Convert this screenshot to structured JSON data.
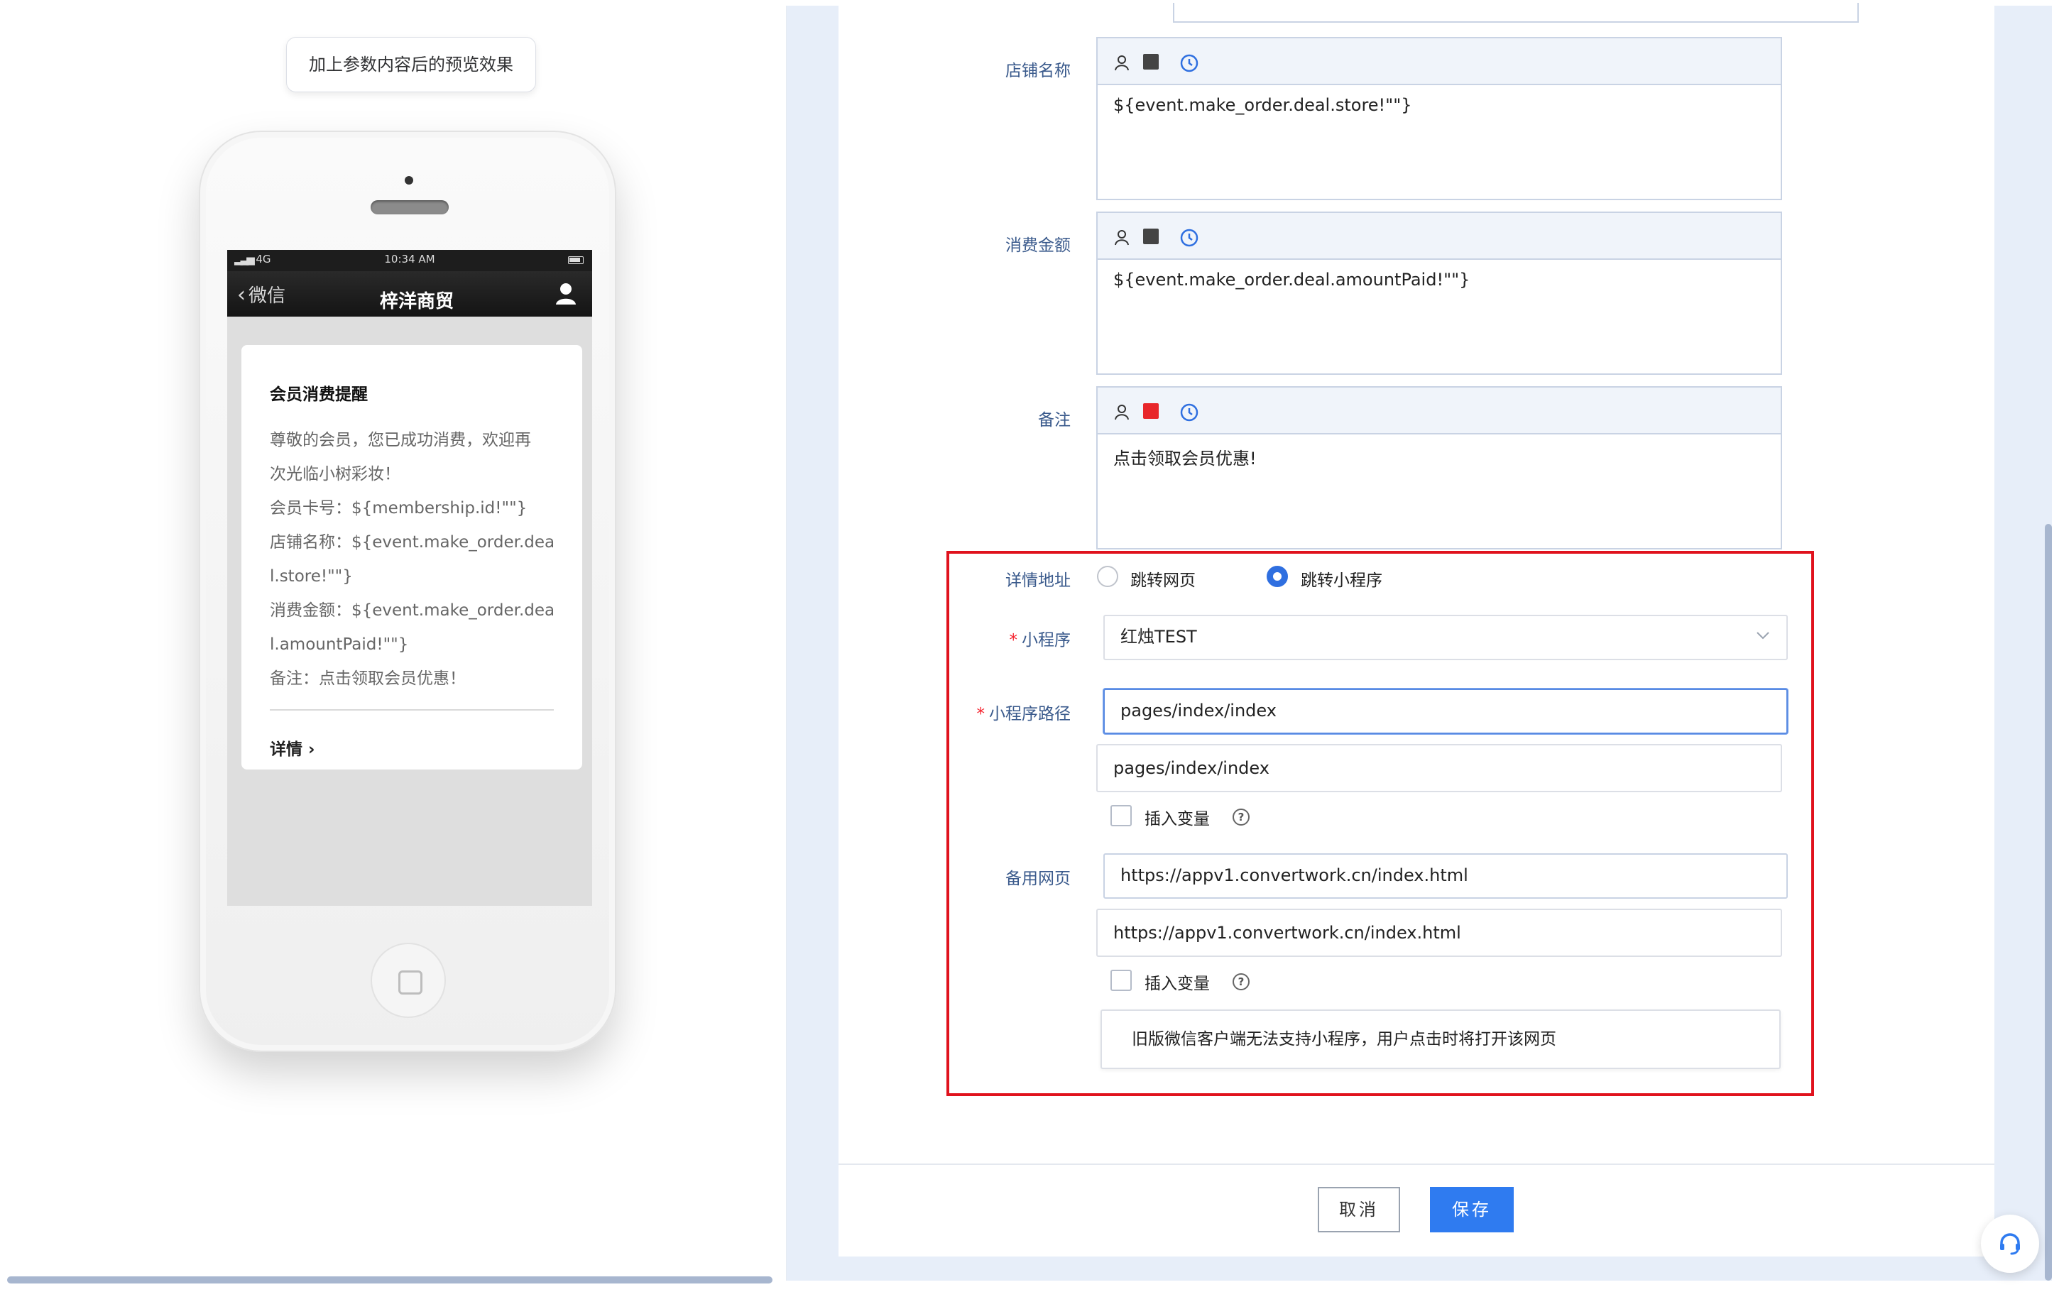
{
  "preview": {
    "caption": "加上参数内容后的预览效果",
    "status_bar": {
      "signal": "4G",
      "time": "10:34 AM"
    },
    "nav": {
      "back_label": "微信",
      "title": "梓洋商贸"
    },
    "card": {
      "title": "会员消费提醒",
      "lines": [
        "尊敬的会员，您已成功消费，欢迎再",
        "次光临小树彩妆！",
        "会员卡号：${membership.id!\"\"}",
        "店铺名称：${event.make_order.dea",
        "l.store!\"\"}",
        "消费金额：${event.make_order.dea",
        "l.amountPaid!\"\"}",
        "备注：点击领取会员优惠！"
      ],
      "detail_link": "详情"
    }
  },
  "form": {
    "fields": [
      {
        "label": "店铺名称",
        "value": "${event.make_order.deal.store!\"\"}",
        "color": "#444444"
      },
      {
        "label": "消费金额",
        "value": "${event.make_order.deal.amountPaid!\"\"}",
        "color": "#444444"
      },
      {
        "label": "备注",
        "value": "点击领取会员优惠!",
        "color": "#e8262a"
      }
    ],
    "detail_address": {
      "label": "详情地址",
      "options": [
        "跳转网页",
        "跳转小程序"
      ],
      "selected": "跳转小程序"
    },
    "mini_program": {
      "label": "小程序",
      "required": true,
      "value": "红烛TEST"
    },
    "mini_program_path": {
      "label": "小程序路径",
      "required": true,
      "input_value": "pages/index/index",
      "preview_value": "pages/index/index",
      "insert_var_label": "插入变量"
    },
    "backup_page": {
      "label": "备用网页",
      "input_value": "https://appv1.convertwork.cn/index.html",
      "preview_value": "https://appv1.convertwork.cn/index.html",
      "insert_var_label": "插入变量",
      "tip": "旧版微信客户端无法支持小程序，用户点击时将打开该网页"
    },
    "buttons": {
      "cancel": "取消",
      "save": "保存"
    }
  },
  "colors": {
    "accent": "#2f7bf0",
    "highlight_border": "#e0121d",
    "label": "#3a5a8c"
  }
}
